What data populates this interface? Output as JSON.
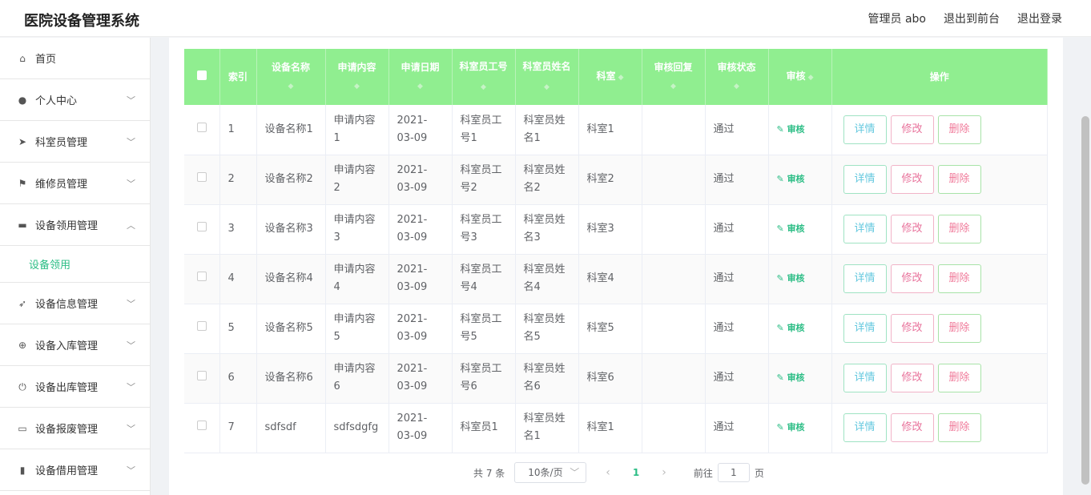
{
  "brand": "医院设备管理系统",
  "topnav": [
    "管理员 abo",
    "退出到前台",
    "退出登录"
  ],
  "sidebar": [
    {
      "label": "首页",
      "icon": "home-icon",
      "chev": ""
    },
    {
      "label": "个人中心",
      "icon": "user-icon",
      "chev": "﹀"
    },
    {
      "label": "科室员管理",
      "icon": "send-icon",
      "chev": "﹀"
    },
    {
      "label": "维修员管理",
      "icon": "flag-icon",
      "chev": "﹀"
    },
    {
      "label": "设备领用管理",
      "icon": "device-icon",
      "chev": "︿"
    },
    {
      "label": "设备信息管理",
      "icon": "navigation-icon",
      "chev": "﹀"
    },
    {
      "label": "设备入库管理",
      "icon": "target-icon",
      "chev": "﹀"
    },
    {
      "label": "设备出库管理",
      "icon": "power-icon",
      "chev": "﹀"
    },
    {
      "label": "设备报废管理",
      "icon": "card-icon",
      "chev": "﹀"
    },
    {
      "label": "设备借用管理",
      "icon": "clipboard-icon",
      "chev": "﹀"
    }
  ],
  "submenu_active": "设备领用",
  "table": {
    "headers": [
      "索引",
      "设备名称",
      "申请内容",
      "申请日期",
      "科室员工号",
      "科室员姓名",
      "科室",
      "审核回复",
      "审核状态",
      "审核",
      "操作"
    ],
    "rows": [
      {
        "idx": "1",
        "name": "设备名称1",
        "content": "申请内容1",
        "date": "2021-03-09",
        "emp_id": "科室员工号1",
        "emp_name": "科室员姓名1",
        "dept": "科室1",
        "reply": "",
        "status": "通过"
      },
      {
        "idx": "2",
        "name": "设备名称2",
        "content": "申请内容2",
        "date": "2021-03-09",
        "emp_id": "科室员工号2",
        "emp_name": "科室员姓名2",
        "dept": "科室2",
        "reply": "",
        "status": "通过"
      },
      {
        "idx": "3",
        "name": "设备名称3",
        "content": "申请内容3",
        "date": "2021-03-09",
        "emp_id": "科室员工号3",
        "emp_name": "科室员姓名3",
        "dept": "科室3",
        "reply": "",
        "status": "通过"
      },
      {
        "idx": "4",
        "name": "设备名称4",
        "content": "申请内容4",
        "date": "2021-03-09",
        "emp_id": "科室员工号4",
        "emp_name": "科室员姓名4",
        "dept": "科室4",
        "reply": "",
        "status": "通过"
      },
      {
        "idx": "5",
        "name": "设备名称5",
        "content": "申请内容5",
        "date": "2021-03-09",
        "emp_id": "科室员工号5",
        "emp_name": "科室员姓名5",
        "dept": "科室5",
        "reply": "",
        "status": "通过"
      },
      {
        "idx": "6",
        "name": "设备名称6",
        "content": "申请内容6",
        "date": "2021-03-09",
        "emp_id": "科室员工号6",
        "emp_name": "科室员姓名6",
        "dept": "科室6",
        "reply": "",
        "status": "通过"
      },
      {
        "idx": "7",
        "name": "sdfsdf",
        "content": "sdfsdgfg",
        "date": "2021-03-09",
        "emp_id": "科室员1",
        "emp_name": "科室员姓名1",
        "dept": "科室1",
        "reply": "",
        "status": "通过"
      }
    ],
    "audit_label": "审核",
    "btn_detail": "详情",
    "btn_edit": "修改",
    "btn_delete": "删除"
  },
  "pager": {
    "total": "共 7 条",
    "size": "10条/页",
    "current": "1",
    "goto": "前往",
    "page_input": "1",
    "page_unit": "页"
  },
  "colors": {
    "accent": "#2bbd85",
    "header": "#90ee90"
  }
}
